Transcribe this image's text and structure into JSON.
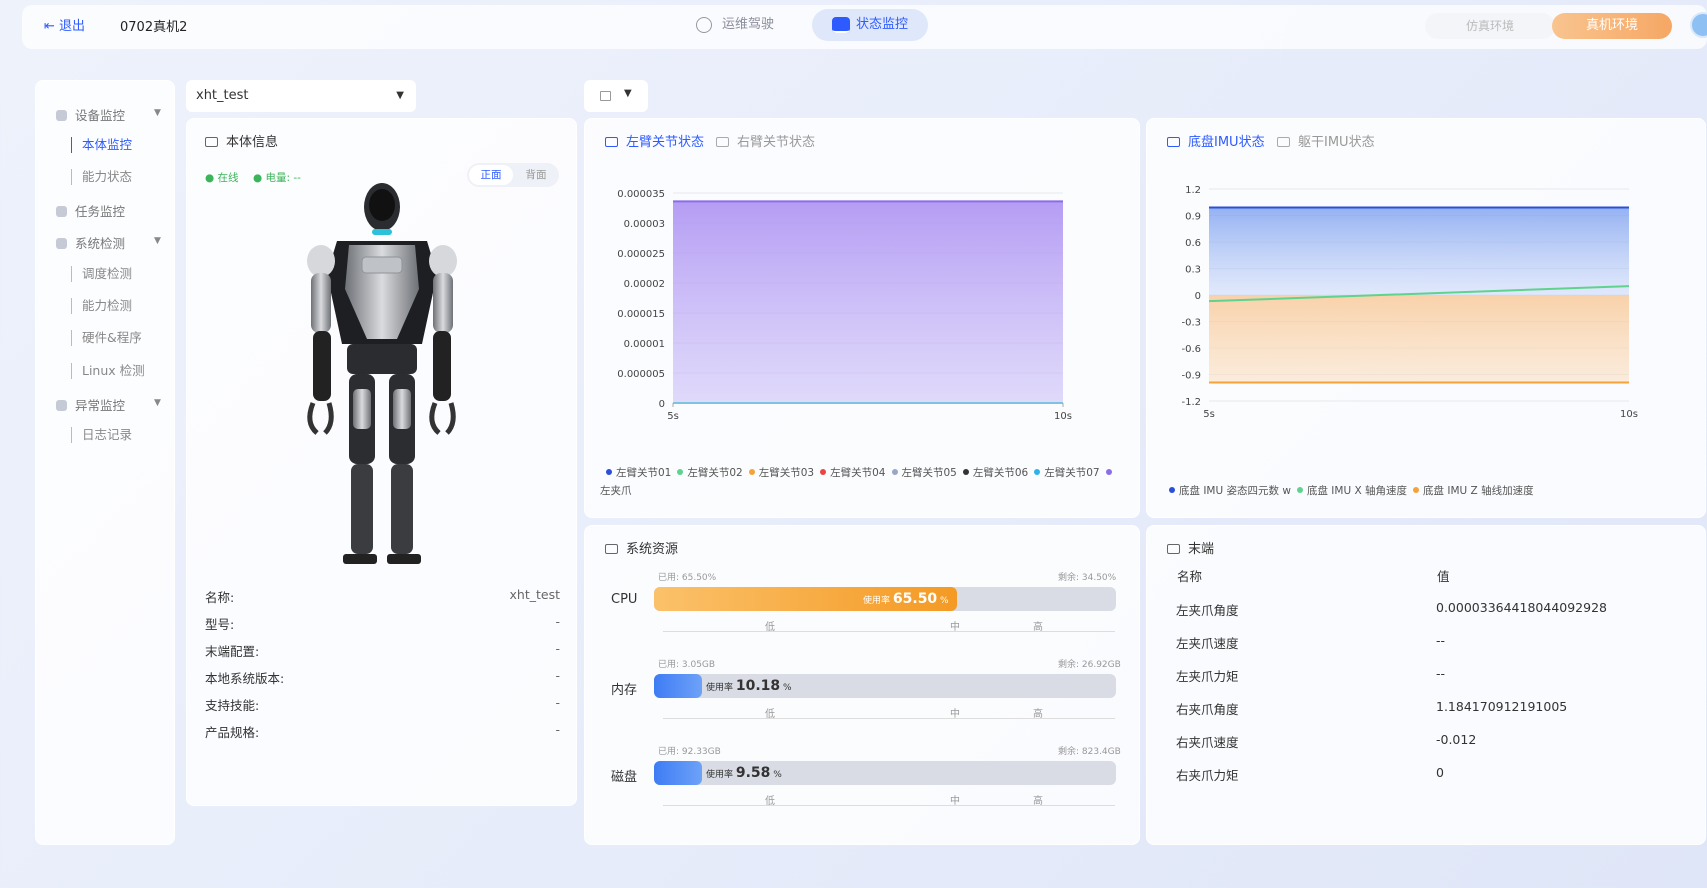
{
  "topbar": {
    "logout_label": "退出",
    "device_name": "0702真机2",
    "nav_ops": "运维驾驶",
    "nav_status": "状态监控",
    "env_sim": "仿真环境",
    "env_real": "真机环境"
  },
  "sidebar": {
    "device_monitor": "设备监控",
    "body_monitor": "本体监控",
    "capability_status": "能力状态",
    "task_monitor": "任务监控",
    "system_check": "系统检测",
    "schedule_check": "调度检测",
    "capability_check": "能力检测",
    "hardware_program": "硬件&程序",
    "linux_check": "Linux 检测",
    "exception_monitor": "异常监控",
    "log_record": "日志记录"
  },
  "robot_select": {
    "value": "xht_test"
  },
  "body_info": {
    "title": "本体信息",
    "online": "在线",
    "battery": "电量: --",
    "view_front": "正面",
    "view_back": "背面",
    "rows": [
      {
        "k": "名称:",
        "v": "xht_test"
      },
      {
        "k": "型号:",
        "v": "-"
      },
      {
        "k": "末端配置:",
        "v": "-"
      },
      {
        "k": "本地系统版本:",
        "v": "-"
      },
      {
        "k": "支持技能:",
        "v": "-"
      },
      {
        "k": "产品规格:",
        "v": "-"
      }
    ]
  },
  "arm_panel": {
    "tab_left": "左臂关节状态",
    "tab_right": "右臂关节状态",
    "legend": [
      {
        "name": "左臂关节01",
        "color": "#2b4fd8"
      },
      {
        "name": "左臂关节02",
        "color": "#5fd38d"
      },
      {
        "name": "左臂关节03",
        "color": "#f5a23a"
      },
      {
        "name": "左臂关节04",
        "color": "#e94545"
      },
      {
        "name": "左臂关节05",
        "color": "#9aa6c8"
      },
      {
        "name": "左臂关节06",
        "color": "#333333"
      },
      {
        "name": "左臂关节07",
        "color": "#2cb3e8"
      },
      {
        "name": "左夹爪",
        "color": "#8a6de8"
      }
    ]
  },
  "imu_panel": {
    "tab_base": "底盘IMU状态",
    "tab_torso": "躯干IMU状态",
    "legend": [
      {
        "name": "底盘 IMU 姿态四元数 w",
        "color": "#2b4fd8"
      },
      {
        "name": "底盘 IMU X 轴角速度",
        "color": "#5fd38d"
      },
      {
        "name": "底盘 IMU Z 轴线加速度",
        "color": "#f5a23a"
      }
    ]
  },
  "chart_data": [
    {
      "type": "area",
      "x": [
        "5s",
        "10s"
      ],
      "y_ticks": [
        "0",
        "0.000005",
        "0.00001",
        "0.000015",
        "0.00002",
        "0.000025",
        "0.00003",
        "0.000035"
      ],
      "ylim": [
        0,
        3.5e-05
      ],
      "series": [
        {
          "name": "左夹爪",
          "values": [
            3.36e-05,
            3.36e-05
          ],
          "color": "#8a6de8"
        },
        {
          "name": "左臂关节07",
          "values": [
            0,
            0
          ],
          "color": "#2cb3e8"
        }
      ]
    },
    {
      "type": "area",
      "x": [
        "5s",
        "10s"
      ],
      "y_ticks": [
        "1.2",
        "0.9",
        "0.6",
        "0.3",
        "0",
        "-0.3",
        "-0.6",
        "-0.9",
        "-1.2"
      ],
      "ylim": [
        -1.2,
        1.2
      ],
      "series": [
        {
          "name": "底盘 IMU 姿态四元数 w",
          "values": [
            0.99,
            0.99
          ],
          "color": "#2b4fd8"
        },
        {
          "name": "底盘 IMU X 轴角速度",
          "values": [
            -0.07,
            0.1
          ],
          "color": "#5fd38d"
        },
        {
          "name": "底盘 IMU Z 轴线加速度",
          "values": [
            -0.99,
            -0.99
          ],
          "color": "#f5a23a"
        }
      ]
    }
  ],
  "resources": {
    "title": "系统资源",
    "usage_word": "使用率",
    "scale": [
      "低",
      "中",
      "高"
    ],
    "items": [
      {
        "label": "CPU",
        "used": "已用: 65.50%",
        "remain": "剩余: 34.50%",
        "pct": "65.50",
        "fraction": 0.655
      },
      {
        "label": "内存",
        "used": "已用: 3.05GB",
        "remain": "剩余: 26.92GB",
        "pct": "10.18",
        "fraction": 0.1018
      },
      {
        "label": "磁盘",
        "used": "已用: 92.33GB",
        "remain": "剩余: 823.4GB",
        "pct": "9.58",
        "fraction": 0.0958
      }
    ]
  },
  "end_effector": {
    "title": "末端",
    "col_name": "名称",
    "col_value": "值",
    "rows": [
      {
        "k": "左夹爪角度",
        "v": "0.00003364418044092928"
      },
      {
        "k": "左夹爪速度",
        "v": "--"
      },
      {
        "k": "左夹爪力矩",
        "v": "--"
      },
      {
        "k": "右夹爪角度",
        "v": "1.184170912191005"
      },
      {
        "k": "右夹爪速度",
        "v": "-0.012"
      },
      {
        "k": "右夹爪力矩",
        "v": "0"
      }
    ]
  }
}
